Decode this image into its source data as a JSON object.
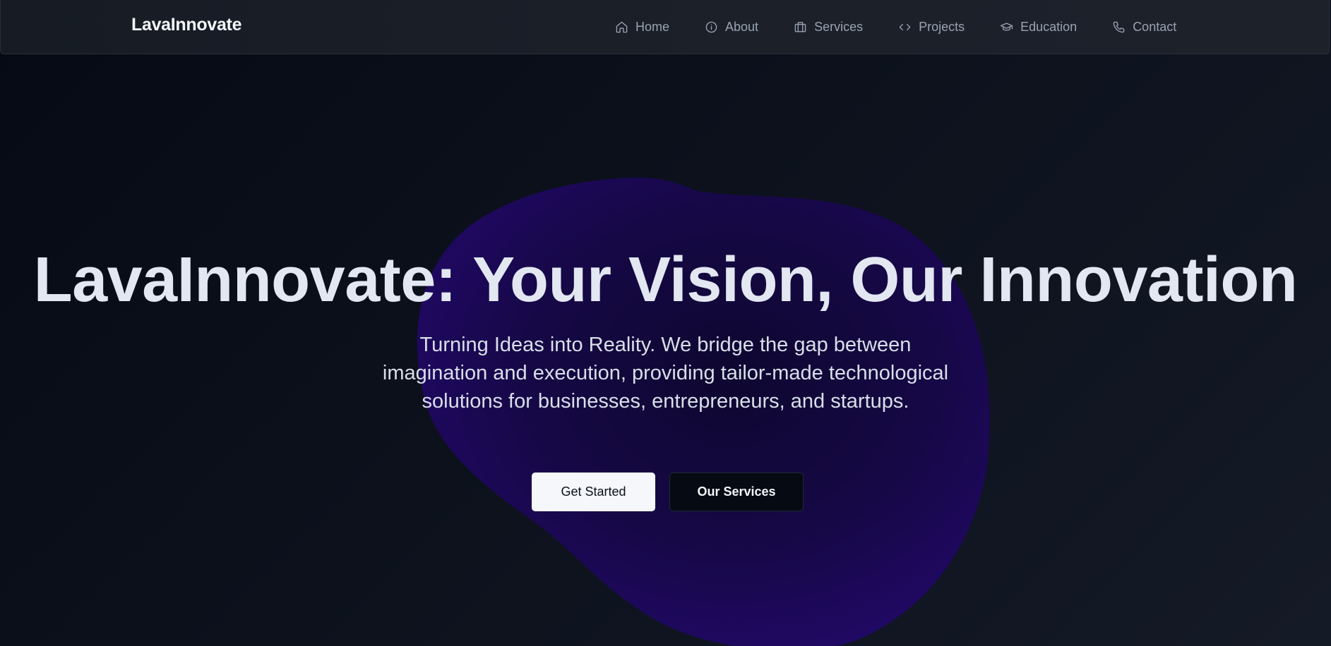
{
  "brand": {
    "name": "LavaInnovate"
  },
  "nav": {
    "items": [
      {
        "label": "Home",
        "icon": "home-icon"
      },
      {
        "label": "About",
        "icon": "info-icon"
      },
      {
        "label": "Services",
        "icon": "briefcase-icon"
      },
      {
        "label": "Projects",
        "icon": "code-icon"
      },
      {
        "label": "Education",
        "icon": "graduation-cap-icon"
      },
      {
        "label": "Contact",
        "icon": "phone-icon"
      }
    ]
  },
  "hero": {
    "title": "LavaInnovate: Your Vision, Our Innovation",
    "subtitle": "Turning Ideas into Reality. We bridge the gap between imagination and execution, providing tailor-made technological solutions for businesses, entrepreneurs, and startups.",
    "primary_button": "Get Started",
    "secondary_button": "Our Services"
  },
  "colors": {
    "background": "#0a0f1a",
    "blob": "#1f0a5a",
    "nav_text": "#9aa3b2",
    "title_text": "#e2e7f1"
  }
}
